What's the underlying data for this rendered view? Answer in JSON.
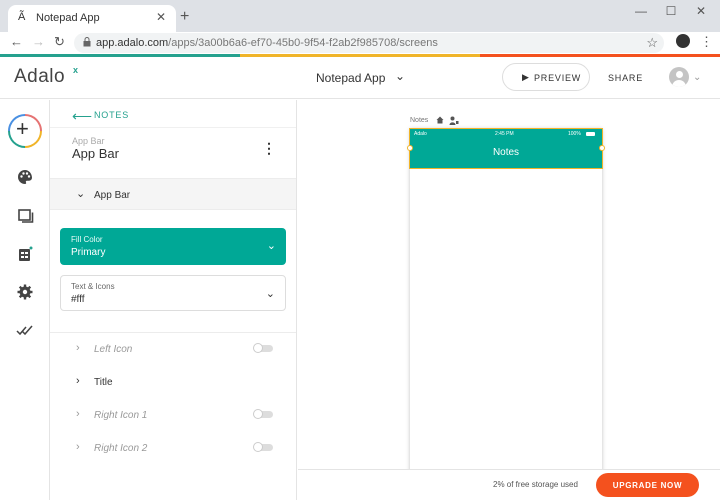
{
  "browser": {
    "tab_title": "Notepad App",
    "url_host": "app.adalo.com",
    "url_path": "/apps/3a00b6a6-ef70-45b0-9f54-f2ab2f985708/screens"
  },
  "colors": {
    "strip": [
      "#25a18e",
      "#f0b429",
      "#f4511e"
    ],
    "primary": "#00a896",
    "upgrade": "#f4511e"
  },
  "header": {
    "logo": "Adalo",
    "logo_mark": "x",
    "app_name": "Notepad App",
    "preview_label": "PREVIEW",
    "share_label": "SHARE"
  },
  "rail": {
    "icons": [
      "add-icon",
      "palette-icon",
      "screens-icon",
      "database-icon",
      "gear-icon",
      "checklist-icon"
    ]
  },
  "panel": {
    "back_label": "NOTES",
    "component_type": "App Bar",
    "component_name": "App Bar",
    "section_label": "App Bar",
    "fill_color_label": "Fill Color",
    "fill_color_value": "Primary",
    "text_icons_label": "Text & Icons",
    "text_icons_value": "#fff",
    "rows": [
      {
        "label": "Left Icon",
        "enabled": false
      },
      {
        "label": "Title",
        "enabled": true
      },
      {
        "label": "Right Icon 1",
        "enabled": false
      },
      {
        "label": "Right Icon 2",
        "enabled": false
      }
    ]
  },
  "canvas": {
    "screen_label": "Notes",
    "status_carrier": "Adalo",
    "status_time": "2:45 PM",
    "status_battery": "100%",
    "appbar_title": "Notes"
  },
  "footer": {
    "storage_text": "2% of free storage used",
    "upgrade_label": "UPGRADE NOW"
  }
}
